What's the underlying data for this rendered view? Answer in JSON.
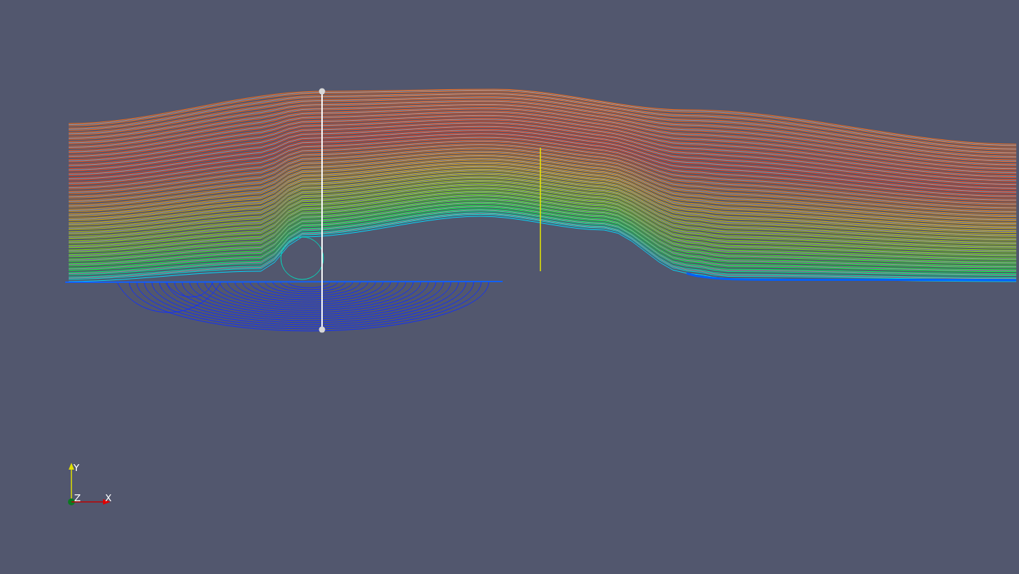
{
  "orientation_axes": [
    {
      "kind": "y",
      "label": "Y"
    },
    {
      "kind": "z",
      "label": "Z"
    },
    {
      "kind": "x",
      "label": "X"
    }
  ]
}
